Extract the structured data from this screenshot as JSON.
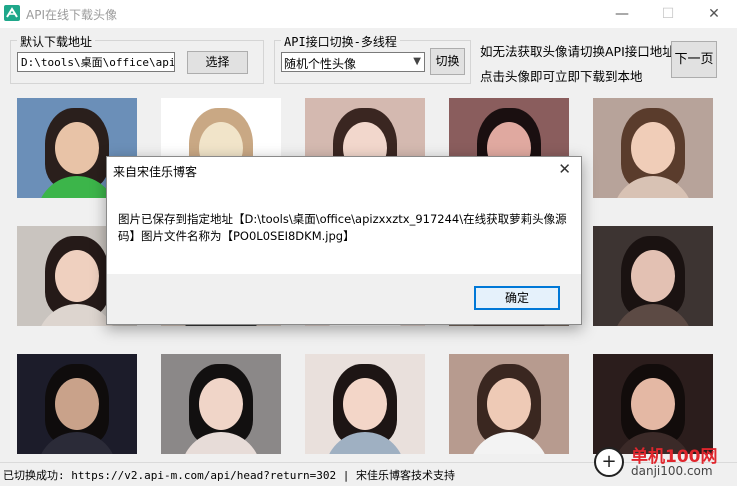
{
  "window": {
    "title": "API在线下载头像"
  },
  "download": {
    "group_label": "默认下载地址",
    "path_value": "D:\\tools\\桌面\\office\\apizx",
    "select_label": "选择"
  },
  "api": {
    "group_label": "API接口切换-多线程",
    "selected_option": "随机个性头像",
    "switch_label": "切换"
  },
  "hints": {
    "line1": "如无法获取头像请切换API接口地址",
    "line2": "点击头像即可立即下载到本地"
  },
  "next_label": "下一页",
  "avatars": [
    {
      "bg": "#6b8fb8",
      "skin": "#e8c3a7",
      "hair": "#2a1f1c",
      "cloth": "#3cb54a"
    },
    {
      "bg": "#ffffff",
      "skin": "#f1e4c9",
      "hair": "#c9a884",
      "cloth": "#e8e8e8"
    },
    {
      "bg": "#d4b9b0",
      "skin": "#f2d7cc",
      "hair": "#3a2621",
      "cloth": "#c7a79a"
    },
    {
      "bg": "#8a5d5d",
      "skin": "#e0a9a0",
      "hair": "#1a0f10",
      "cloth": "#5a2a2c"
    },
    {
      "bg": "#b7a39a",
      "skin": "#f0cdb8",
      "hair": "#5a3c2c",
      "cloth": "#d8c2b4"
    },
    {
      "bg": "#c9c4bf",
      "skin": "#efd0bf",
      "hair": "#251a18",
      "cloth": "#ddd5cf"
    },
    {
      "bg": "#d6c7bd",
      "skin": "#f4dacb",
      "hair": "#2b1f1c",
      "cloth": "#3a3a3a"
    },
    {
      "bg": "#e3d5cf",
      "skin": "#f1d4c4",
      "hair": "#2c1f1c",
      "cloth": "#ffffff"
    },
    {
      "bg": "#7b6b62",
      "skin": "#d9b49e",
      "hair": "#2b1e1a",
      "cloth": "#5b4b43"
    },
    {
      "bg": "#3d3432",
      "skin": "#e3c1b3",
      "hair": "#1a1211",
      "cloth": "#5c4a44"
    },
    {
      "bg": "#1c1c2a",
      "skin": "#c9a28a",
      "hair": "#0f0c0c",
      "cloth": "#2b2b38"
    },
    {
      "bg": "#8b8888",
      "skin": "#f0d5c8",
      "hair": "#121010",
      "cloth": "#e7dcd8"
    },
    {
      "bg": "#e9e0dc",
      "skin": "#f3d6c8",
      "hair": "#1d1514",
      "cloth": "#9fb0c2"
    },
    {
      "bg": "#b79b8f",
      "skin": "#eecab6",
      "hair": "#3a2720",
      "cloth": "#f3f3f3"
    },
    {
      "bg": "#2b1d1c",
      "skin": "#e4b8a4",
      "hair": "#120c0b",
      "cloth": "#3b2a28"
    }
  ],
  "status": {
    "text": "已切换成功: https://v2.api-m.com/api/head?return=302 | 宋佳乐博客技术支持"
  },
  "dialog": {
    "title": "来自宋佳乐博客",
    "message": "图片已保存到指定地址【D:\\tools\\桌面\\office\\apizxxztx_917244\\在线获取萝莉头像源码】图片文件名称为【PO0L0SEI8DKM.jpg】",
    "ok_label": "确定"
  },
  "watermark": {
    "cn": "单机100网",
    "en": "danji100.com"
  }
}
